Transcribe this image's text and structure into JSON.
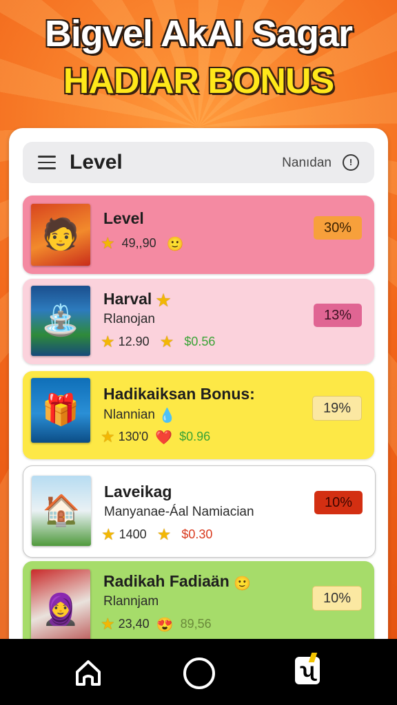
{
  "banner": {
    "title": "Bigvel AkAI Sagar",
    "subtitle": "HADIAR BONUS"
  },
  "appbar": {
    "title": "Level",
    "right_label": "Nanıdan",
    "menu_icon": "hamburger-menu-icon",
    "info_icon": "info-circle-icon"
  },
  "cards": [
    {
      "title": "Level",
      "subtitle": "",
      "rating": "49,,90",
      "value": "",
      "badge": "30%",
      "badge_color": "#f7a03b",
      "card_color": "#f48aa2"
    },
    {
      "title": "Harval",
      "subtitle": "Rlanojan",
      "rating": "12.90",
      "value": "$0.56",
      "badge": "13%",
      "badge_color": "#e06593",
      "card_color": "#fbd2dc"
    },
    {
      "title": "Hadikaiksan Bonus:",
      "subtitle": "Nlannian",
      "rating": "130'0",
      "value": "$0.96",
      "badge": "19%",
      "badge_color": "#fbe8a2",
      "card_color": "#fde846"
    },
    {
      "title": "Laveikag",
      "subtitle": "Manyanae-Áal Namiacian",
      "rating": "1400",
      "value": "$0.30",
      "badge": "10%",
      "badge_color": "#d32f12",
      "card_color": "#ffffff"
    },
    {
      "title": "Radikah Fadiaän",
      "subtitle": "Rlannjam",
      "rating": "23,40",
      "value": "89,56",
      "badge": "10%",
      "badge_color": "#fbe8a2",
      "card_color": "#a6dc6a"
    }
  ],
  "navbar": {
    "home_icon": "home-icon",
    "circle_icon": "circle-home-button-icon",
    "recent_icon": "app-switcher-icon"
  }
}
